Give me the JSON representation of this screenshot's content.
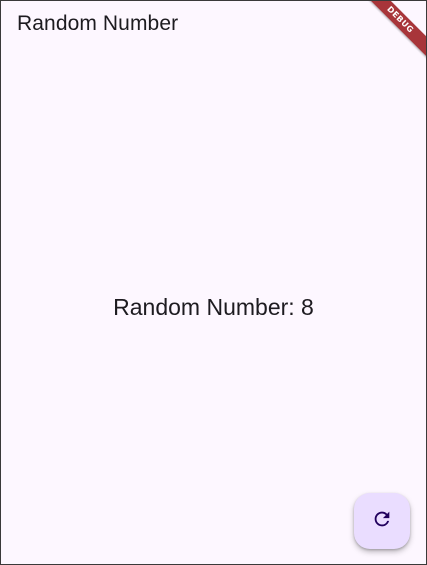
{
  "app_bar": {
    "title": "Random Number"
  },
  "body": {
    "random_text": "Random Number: 8"
  },
  "fab": {
    "icon": "refresh-icon"
  },
  "debug_banner": {
    "label": "DEBUG"
  },
  "colors": {
    "background": "#fdf7ff",
    "fab_background": "#eaddff",
    "fab_icon": "#21005d",
    "banner": "#a8353a"
  }
}
